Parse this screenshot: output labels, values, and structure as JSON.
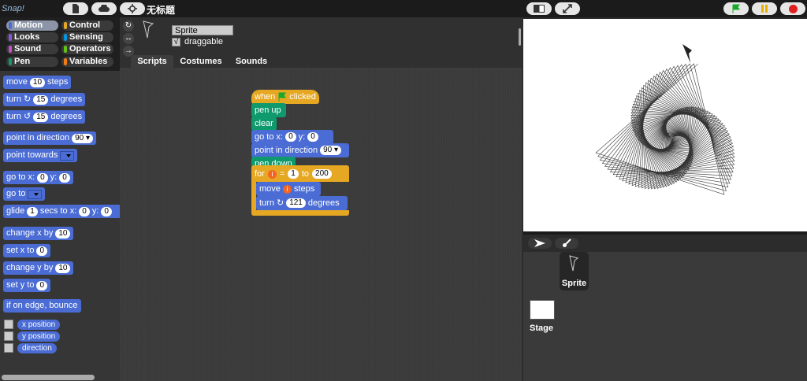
{
  "app": {
    "title": "无标题",
    "logo": "Snap!"
  },
  "categories": [
    {
      "label": "Motion",
      "color": "#4a6cd4",
      "selected": true
    },
    {
      "label": "Control",
      "color": "#e6a822",
      "selected": false
    },
    {
      "label": "Looks",
      "color": "#8a55d7",
      "selected": false
    },
    {
      "label": "Sensing",
      "color": "#0494dc",
      "selected": false
    },
    {
      "label": "Sound",
      "color": "#c94fc9",
      "selected": false
    },
    {
      "label": "Operators",
      "color": "#62c213",
      "selected": false
    },
    {
      "label": "Pen",
      "color": "#0e9a6c",
      "selected": false
    },
    {
      "label": "Variables",
      "color": "#ee7d16",
      "selected": false
    }
  ],
  "palette": {
    "move": {
      "a": "move",
      "v": "10",
      "b": "steps"
    },
    "turn_cw": {
      "a": "turn",
      "v": "15",
      "b": "degrees"
    },
    "turn_ccw": {
      "a": "turn",
      "v": "15",
      "b": "degrees"
    },
    "point_dir": {
      "a": "point in direction",
      "v": "90"
    },
    "point_towards": {
      "a": "point towards"
    },
    "goto_xy": {
      "a": "go to x:",
      "x": "0",
      "b": "y:",
      "y": "0"
    },
    "goto": {
      "a": "go to"
    },
    "glide": {
      "a": "glide",
      "v": "1",
      "b": "secs to x:",
      "x": "0",
      "c": "y:",
      "y": "0"
    },
    "change_x": {
      "a": "change x by",
      "v": "10"
    },
    "set_x": {
      "a": "set x to",
      "v": "0"
    },
    "change_y": {
      "a": "change y by",
      "v": "10"
    },
    "set_y": {
      "a": "set y to",
      "v": "0"
    },
    "bounce": {
      "a": "if on edge, bounce"
    },
    "reporters": [
      "x position",
      "y position",
      "direction"
    ]
  },
  "sprite": {
    "name": "Sprite",
    "draggable_label": "draggable",
    "draggable_mark": "√"
  },
  "tabs": [
    {
      "label": "Scripts",
      "selected": true
    },
    {
      "label": "Costumes",
      "selected": false
    },
    {
      "label": "Sounds",
      "selected": false
    }
  ],
  "script": {
    "hat": {
      "a": "when",
      "b": "clicked"
    },
    "pen_up": "pen up",
    "clear": "clear",
    "goto_xy": {
      "a": "go to x:",
      "x": "0",
      "b": "y:",
      "y": "0"
    },
    "point_dir": {
      "a": "point in direction",
      "v": "90"
    },
    "pen_down": "pen down",
    "for": {
      "a": "for",
      "var": "i",
      "eq": "=",
      "from": "1",
      "to_lbl": "to",
      "to": "200"
    },
    "move": {
      "a": "move",
      "var": "i",
      "b": "steps"
    },
    "turn": {
      "a": "turn",
      "v": "121",
      "b": "degrees"
    }
  },
  "corral": {
    "sprite_label": "Sprite",
    "stage_label": "Stage"
  },
  "spiral": {
    "steps": 200,
    "turn_deg": 121
  }
}
